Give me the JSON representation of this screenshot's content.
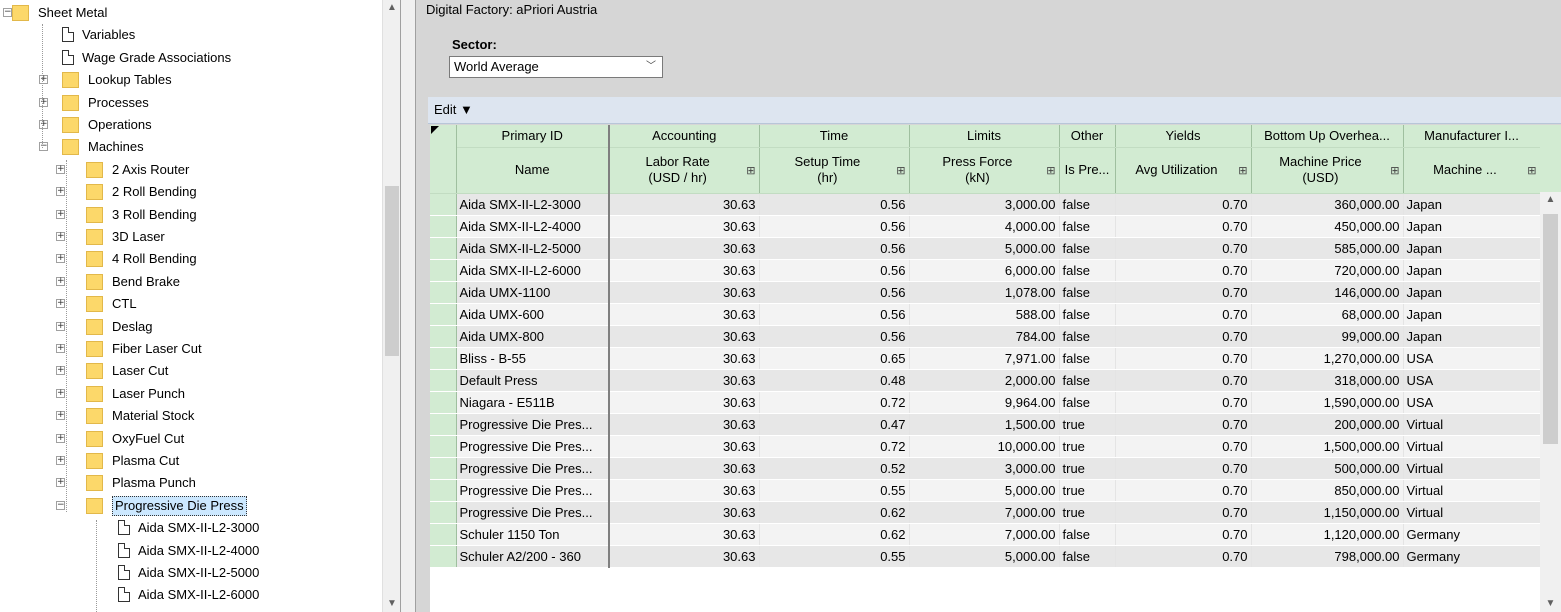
{
  "tree": {
    "items": [
      {
        "label": "Sheet Metal",
        "level": 0,
        "type": "folder",
        "expander": "−"
      },
      {
        "label": "Variables",
        "level": 1,
        "type": "doc",
        "expander": ""
      },
      {
        "label": "Wage Grade Associations",
        "level": 1,
        "type": "doc",
        "expander": ""
      },
      {
        "label": "Lookup Tables",
        "level": 1,
        "type": "folder",
        "expander": "+"
      },
      {
        "label": "Processes",
        "level": 1,
        "type": "folder",
        "expander": "+"
      },
      {
        "label": "Operations",
        "level": 1,
        "type": "folder",
        "expander": "+"
      },
      {
        "label": "Machines",
        "level": 1,
        "type": "folder",
        "expander": "−"
      },
      {
        "label": "2 Axis Router",
        "level": 2,
        "type": "folder",
        "expander": "+"
      },
      {
        "label": "2 Roll Bending",
        "level": 2,
        "type": "folder",
        "expander": "+"
      },
      {
        "label": "3 Roll Bending",
        "level": 2,
        "type": "folder",
        "expander": "+"
      },
      {
        "label": "3D Laser",
        "level": 2,
        "type": "folder",
        "expander": "+"
      },
      {
        "label": "4 Roll Bending",
        "level": 2,
        "type": "folder",
        "expander": "+"
      },
      {
        "label": "Bend Brake",
        "level": 2,
        "type": "folder",
        "expander": "+"
      },
      {
        "label": "CTL",
        "level": 2,
        "type": "folder",
        "expander": "+"
      },
      {
        "label": "Deslag",
        "level": 2,
        "type": "folder",
        "expander": "+"
      },
      {
        "label": "Fiber Laser Cut",
        "level": 2,
        "type": "folder",
        "expander": "+"
      },
      {
        "label": "Laser Cut",
        "level": 2,
        "type": "folder",
        "expander": "+"
      },
      {
        "label": "Laser Punch",
        "level": 2,
        "type": "folder",
        "expander": "+"
      },
      {
        "label": "Material Stock",
        "level": 2,
        "type": "folder",
        "expander": "+"
      },
      {
        "label": "OxyFuel Cut",
        "level": 2,
        "type": "folder",
        "expander": "+"
      },
      {
        "label": "Plasma Cut",
        "level": 2,
        "type": "folder",
        "expander": "+"
      },
      {
        "label": "Plasma Punch",
        "level": 2,
        "type": "folder",
        "expander": "+"
      },
      {
        "label": "Progressive Die Press",
        "level": 2,
        "type": "folder",
        "expander": "−",
        "selected": true
      },
      {
        "label": "Aida SMX-II-L2-3000",
        "level": 3,
        "type": "doc",
        "expander": ""
      },
      {
        "label": "Aida SMX-II-L2-4000",
        "level": 3,
        "type": "doc",
        "expander": ""
      },
      {
        "label": "Aida SMX-II-L2-5000",
        "level": 3,
        "type": "doc",
        "expander": ""
      },
      {
        "label": "Aida SMX-II-L2-6000",
        "level": 3,
        "type": "doc",
        "expander": ""
      }
    ]
  },
  "header": {
    "factory_title": "Digital Factory: aPriori Austria"
  },
  "sector": {
    "label": "Sector:",
    "value": "World Average"
  },
  "toolbar": {
    "edit_label": "Edit ▼"
  },
  "grid": {
    "groups": [
      "Primary ID",
      "Accounting",
      "Time",
      "Limits",
      "Other",
      "Yields",
      "Bottom Up Overhea...",
      "Manufacturer I..."
    ],
    "columns": [
      {
        "label": "Name",
        "icon": false
      },
      {
        "label": "Labor Rate\n(USD / hr)",
        "icon": true
      },
      {
        "label": "Setup Time\n(hr)",
        "icon": true
      },
      {
        "label": "Press Force\n(kN)",
        "icon": true
      },
      {
        "label": "Is Pre...",
        "icon": false
      },
      {
        "label": "Avg Utilization",
        "icon": true
      },
      {
        "label": "Machine Price\n(USD)",
        "icon": true
      },
      {
        "label": "Machine ...",
        "icon": true
      }
    ],
    "header_icon": "⊞",
    "rows": [
      [
        "Aida SMX-II-L2-3000",
        "30.63",
        "0.56",
        "3,000.00",
        "false",
        "0.70",
        "360,000.00",
        "Japan"
      ],
      [
        "Aida SMX-II-L2-4000",
        "30.63",
        "0.56",
        "4,000.00",
        "false",
        "0.70",
        "450,000.00",
        "Japan"
      ],
      [
        "Aida SMX-II-L2-5000",
        "30.63",
        "0.56",
        "5,000.00",
        "false",
        "0.70",
        "585,000.00",
        "Japan"
      ],
      [
        "Aida SMX-II-L2-6000",
        "30.63",
        "0.56",
        "6,000.00",
        "false",
        "0.70",
        "720,000.00",
        "Japan"
      ],
      [
        "Aida UMX-1100",
        "30.63",
        "0.56",
        "1,078.00",
        "false",
        "0.70",
        "146,000.00",
        "Japan"
      ],
      [
        "Aida UMX-600",
        "30.63",
        "0.56",
        "588.00",
        "false",
        "0.70",
        "68,000.00",
        "Japan"
      ],
      [
        "Aida UMX-800",
        "30.63",
        "0.56",
        "784.00",
        "false",
        "0.70",
        "99,000.00",
        "Japan"
      ],
      [
        "Bliss - B-55",
        "30.63",
        "0.65",
        "7,971.00",
        "false",
        "0.70",
        "1,270,000.00",
        "USA"
      ],
      [
        "Default Press",
        "30.63",
        "0.48",
        "2,000.00",
        "false",
        "0.70",
        "318,000.00",
        "USA"
      ],
      [
        "Niagara - E511B",
        "30.63",
        "0.72",
        "9,964.00",
        "false",
        "0.70",
        "1,590,000.00",
        "USA"
      ],
      [
        "Progressive Die Pres...",
        "30.63",
        "0.47",
        "1,500.00",
        "true",
        "0.70",
        "200,000.00",
        "Virtual"
      ],
      [
        "Progressive Die Pres...",
        "30.63",
        "0.72",
        "10,000.00",
        "true",
        "0.70",
        "1,500,000.00",
        "Virtual"
      ],
      [
        "Progressive Die Pres...",
        "30.63",
        "0.52",
        "3,000.00",
        "true",
        "0.70",
        "500,000.00",
        "Virtual"
      ],
      [
        "Progressive Die Pres...",
        "30.63",
        "0.55",
        "5,000.00",
        "true",
        "0.70",
        "850,000.00",
        "Virtual"
      ],
      [
        "Progressive Die Pres...",
        "30.63",
        "0.62",
        "7,000.00",
        "true",
        "0.70",
        "1,150,000.00",
        "Virtual"
      ],
      [
        "Schuler 1150 Ton",
        "30.63",
        "0.62",
        "7,000.00",
        "false",
        "0.70",
        "1,120,000.00",
        "Germany"
      ],
      [
        "Schuler A2/200 - 360",
        "30.63",
        "0.55",
        "5,000.00",
        "false",
        "0.70",
        "798,000.00",
        "Germany"
      ]
    ]
  },
  "icons": {
    "scroll_up": "▲",
    "scroll_down": "▼",
    "select_arrow": "﹀"
  }
}
